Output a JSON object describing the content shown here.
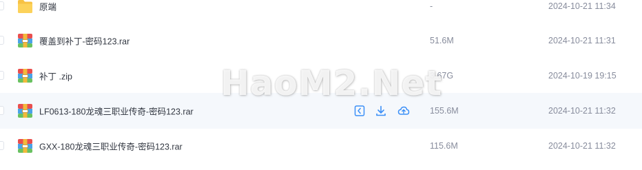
{
  "files": [
    {
      "name": "原端",
      "size": "-",
      "date": "2024-10-21 11:34",
      "type": "folder",
      "icon": "folder-icon"
    },
    {
      "name": "覆盖到补丁-密码123.rar",
      "size": "51.6M",
      "date": "2024-10-21 11:31",
      "type": "archive",
      "icon": "archive-icon"
    },
    {
      "name": "补丁 .zip",
      "size": "3.67G",
      "date": "2024-10-19 19:15",
      "type": "archive",
      "icon": "archive-icon"
    },
    {
      "name": "LF0613-180龙魂三职业传奇-密码123.rar",
      "size": "155.6M",
      "date": "2024-10-21 11:32",
      "type": "archive",
      "icon": "archive-icon",
      "hovered": true
    },
    {
      "name": "GXX-180龙魂三职业传奇-密码123.rar",
      "size": "115.6M",
      "date": "2024-10-21 11:32",
      "type": "archive",
      "icon": "archive-icon"
    }
  ],
  "row_actions": [
    "share-icon",
    "download-icon",
    "cloud-upload-icon"
  ],
  "watermark": "HaoM2.Net",
  "colors": {
    "folder": "#f7c244",
    "archive_top": "#e94e4e",
    "archive_mid": "#4aa3e8",
    "archive_bottom": "#69c161",
    "archive_band": "#f2b93b",
    "action": "#3b8ff7",
    "hover_row": "#f5f8fc"
  }
}
